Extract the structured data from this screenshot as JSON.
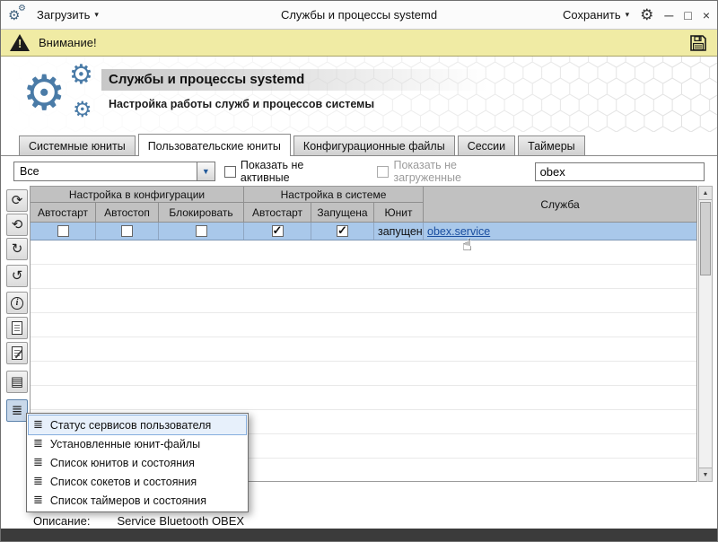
{
  "glyphs": {
    "gear": "⚙",
    "caret": "▾",
    "dropdown_arrow": "▼",
    "minimize": "─",
    "maximize": "□",
    "close": "×",
    "warning_excl": "!",
    "scroll_up": "▲",
    "scroll_down": "▼",
    "hand_cursor": "☝",
    "menu_item_icon": "≣"
  },
  "titlebar": {
    "load_label": "Загрузить",
    "title": "Службы и процессы systemd",
    "save_label": "Сохранить"
  },
  "warning": {
    "label": "Внимание!"
  },
  "header": {
    "title": "Службы и процессы systemd",
    "subtitle": "Настройка работы служб и процессов системы"
  },
  "tabs": [
    {
      "label": "Системные юниты",
      "active": false
    },
    {
      "label": "Пользовательские юниты",
      "active": true
    },
    {
      "label": "Конфигурационные файлы",
      "active": false
    },
    {
      "label": "Сессии",
      "active": false
    },
    {
      "label": "Таймеры",
      "active": false
    }
  ],
  "filters": {
    "unit_filter_value": "Все",
    "show_inactive_label": "Показать не активные",
    "show_inactive_checked": false,
    "show_unloaded_label": "Показать не загруженные",
    "show_unloaded_checked": false,
    "search_value": "obex"
  },
  "toolbar": {
    "buttons": [
      {
        "name": "refresh-button",
        "glyph": "⟳"
      },
      {
        "name": "restart-button",
        "glyph": "⟲"
      },
      {
        "name": "redo-button",
        "glyph": "↻"
      },
      {
        "name": "undo-button",
        "glyph": "↺"
      },
      {
        "name": "info-button",
        "glyph": "i"
      },
      {
        "name": "file-button",
        "glyph": ""
      },
      {
        "name": "file-edit-button",
        "glyph": ""
      },
      {
        "name": "list-button",
        "glyph": "▤"
      },
      {
        "name": "status-menu-button",
        "glyph": "≣"
      }
    ]
  },
  "table": {
    "group_headers": [
      "Настройка в конфигурации",
      "Настройка в системе"
    ],
    "columns": [
      "Автостарт",
      "Автостоп",
      "Блокировать",
      "Автостарт",
      "Запущена",
      "Юнит"
    ],
    "service_column": "Служба",
    "row": {
      "config_autostart": false,
      "config_autostop": false,
      "config_block": false,
      "system_autostart": true,
      "system_running": true,
      "unit_state": "запущен",
      "service": "obex.service"
    }
  },
  "context_menu": {
    "items": [
      "Статус сервисов пользователя",
      "Установленные юнит-файлы",
      "Список юнитов и состояния",
      "Список сокетов и состояния",
      "Список таймеров и состояния"
    ]
  },
  "status": {
    "label": "Описание:",
    "value": "Service Bluetooth OBEX"
  },
  "colors": {
    "selection": "#a9c8ea",
    "warning_bg": "#f0eba4",
    "accent": "#4a7ba7",
    "link": "#1b4fa0",
    "header_gray": "#c1c1c1"
  }
}
